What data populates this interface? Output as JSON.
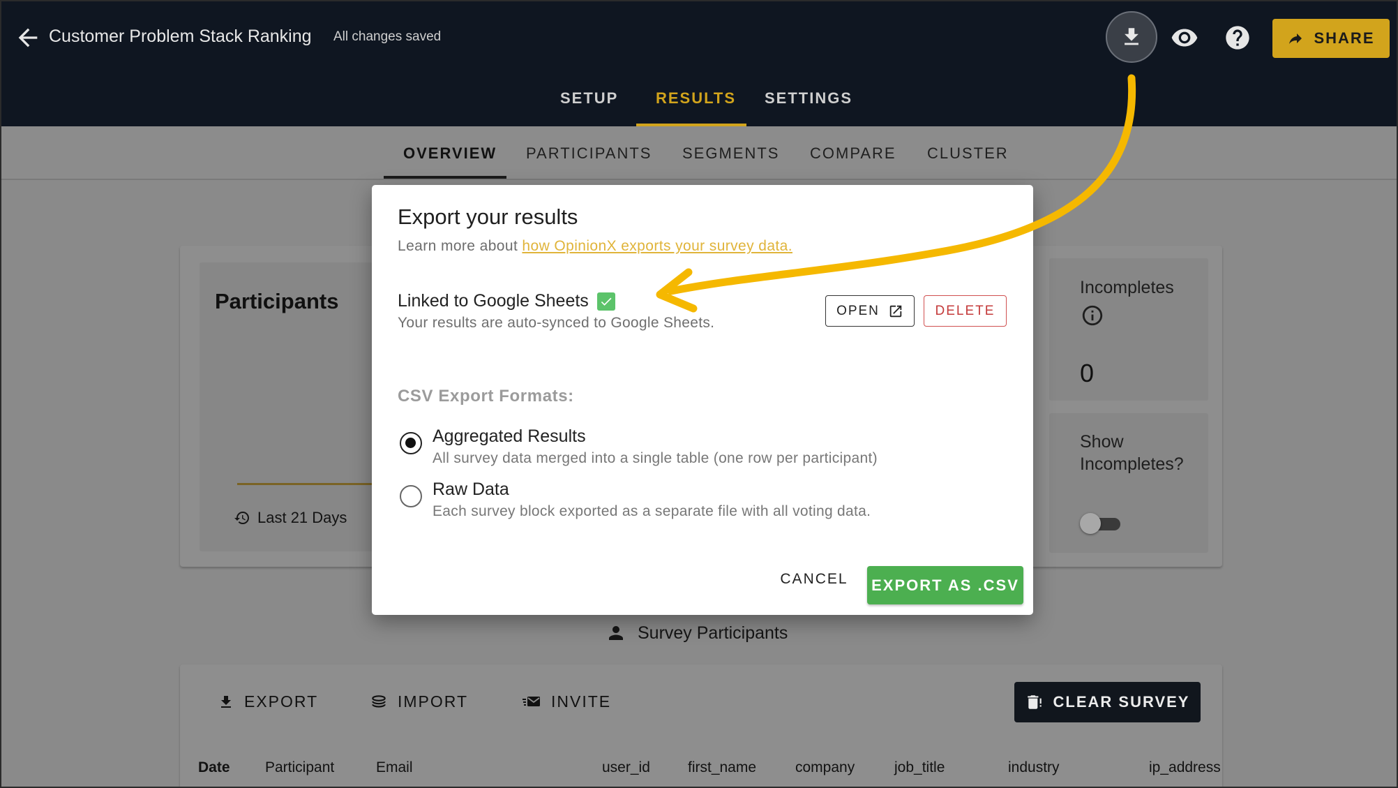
{
  "header": {
    "title": "Customer Problem Stack Ranking",
    "save_status": "All changes saved",
    "share_label": "SHARE"
  },
  "main_tabs": [
    {
      "label": "SETUP",
      "active": false
    },
    {
      "label": "RESULTS",
      "active": true
    },
    {
      "label": "SETTINGS",
      "active": false
    }
  ],
  "sub_tabs": [
    {
      "label": "OVERVIEW",
      "active": true
    },
    {
      "label": "PARTICIPANTS",
      "active": false
    },
    {
      "label": "SEGMENTS",
      "active": false
    },
    {
      "label": "COMPARE",
      "active": false
    },
    {
      "label": "CLUSTER",
      "active": false
    }
  ],
  "overview": {
    "participants_title": "Participants",
    "range_label": "Last 21 Days",
    "incompletes_label": "Incompletes",
    "incompletes_value": "0",
    "show_incompletes_label": "Show Incompletes?",
    "show_incompletes_on": false
  },
  "participants_section": {
    "title": "Survey Participants",
    "export_label": "EXPORT",
    "import_label": "IMPORT",
    "invite_label": "INVITE",
    "clear_label": "CLEAR SURVEY",
    "columns": [
      "Date",
      "Participant",
      "Email",
      "user_id",
      "first_name",
      "company",
      "job_title",
      "industry",
      "ip_address"
    ]
  },
  "dialog": {
    "title": "Export your results",
    "subtitle_prefix": "Learn more about ",
    "subtitle_link": "how OpinionX exports your survey data.",
    "linked_title": "Linked to Google Sheets",
    "linked_desc": "Your results are auto-synced to Google Sheets.",
    "open_label": "OPEN",
    "delete_label": "DELETE",
    "csv_label": "CSV Export Formats:",
    "options": [
      {
        "title": "Aggregated Results",
        "desc": "All survey data merged into a single table (one row per participant)",
        "selected": true
      },
      {
        "title": "Raw Data",
        "desc": "Each survey block exported as a separate file with all voting data.",
        "selected": false
      }
    ],
    "cancel_label": "CANCEL",
    "export_label": "EXPORT AS .CSV"
  },
  "colors": {
    "topbar": "#0f1621",
    "accent": "#d2a41c",
    "export_green": "#4caf50",
    "delete_red": "#c43a3a",
    "arrow": "#f5b800",
    "checkbox": "#5cc36a"
  }
}
